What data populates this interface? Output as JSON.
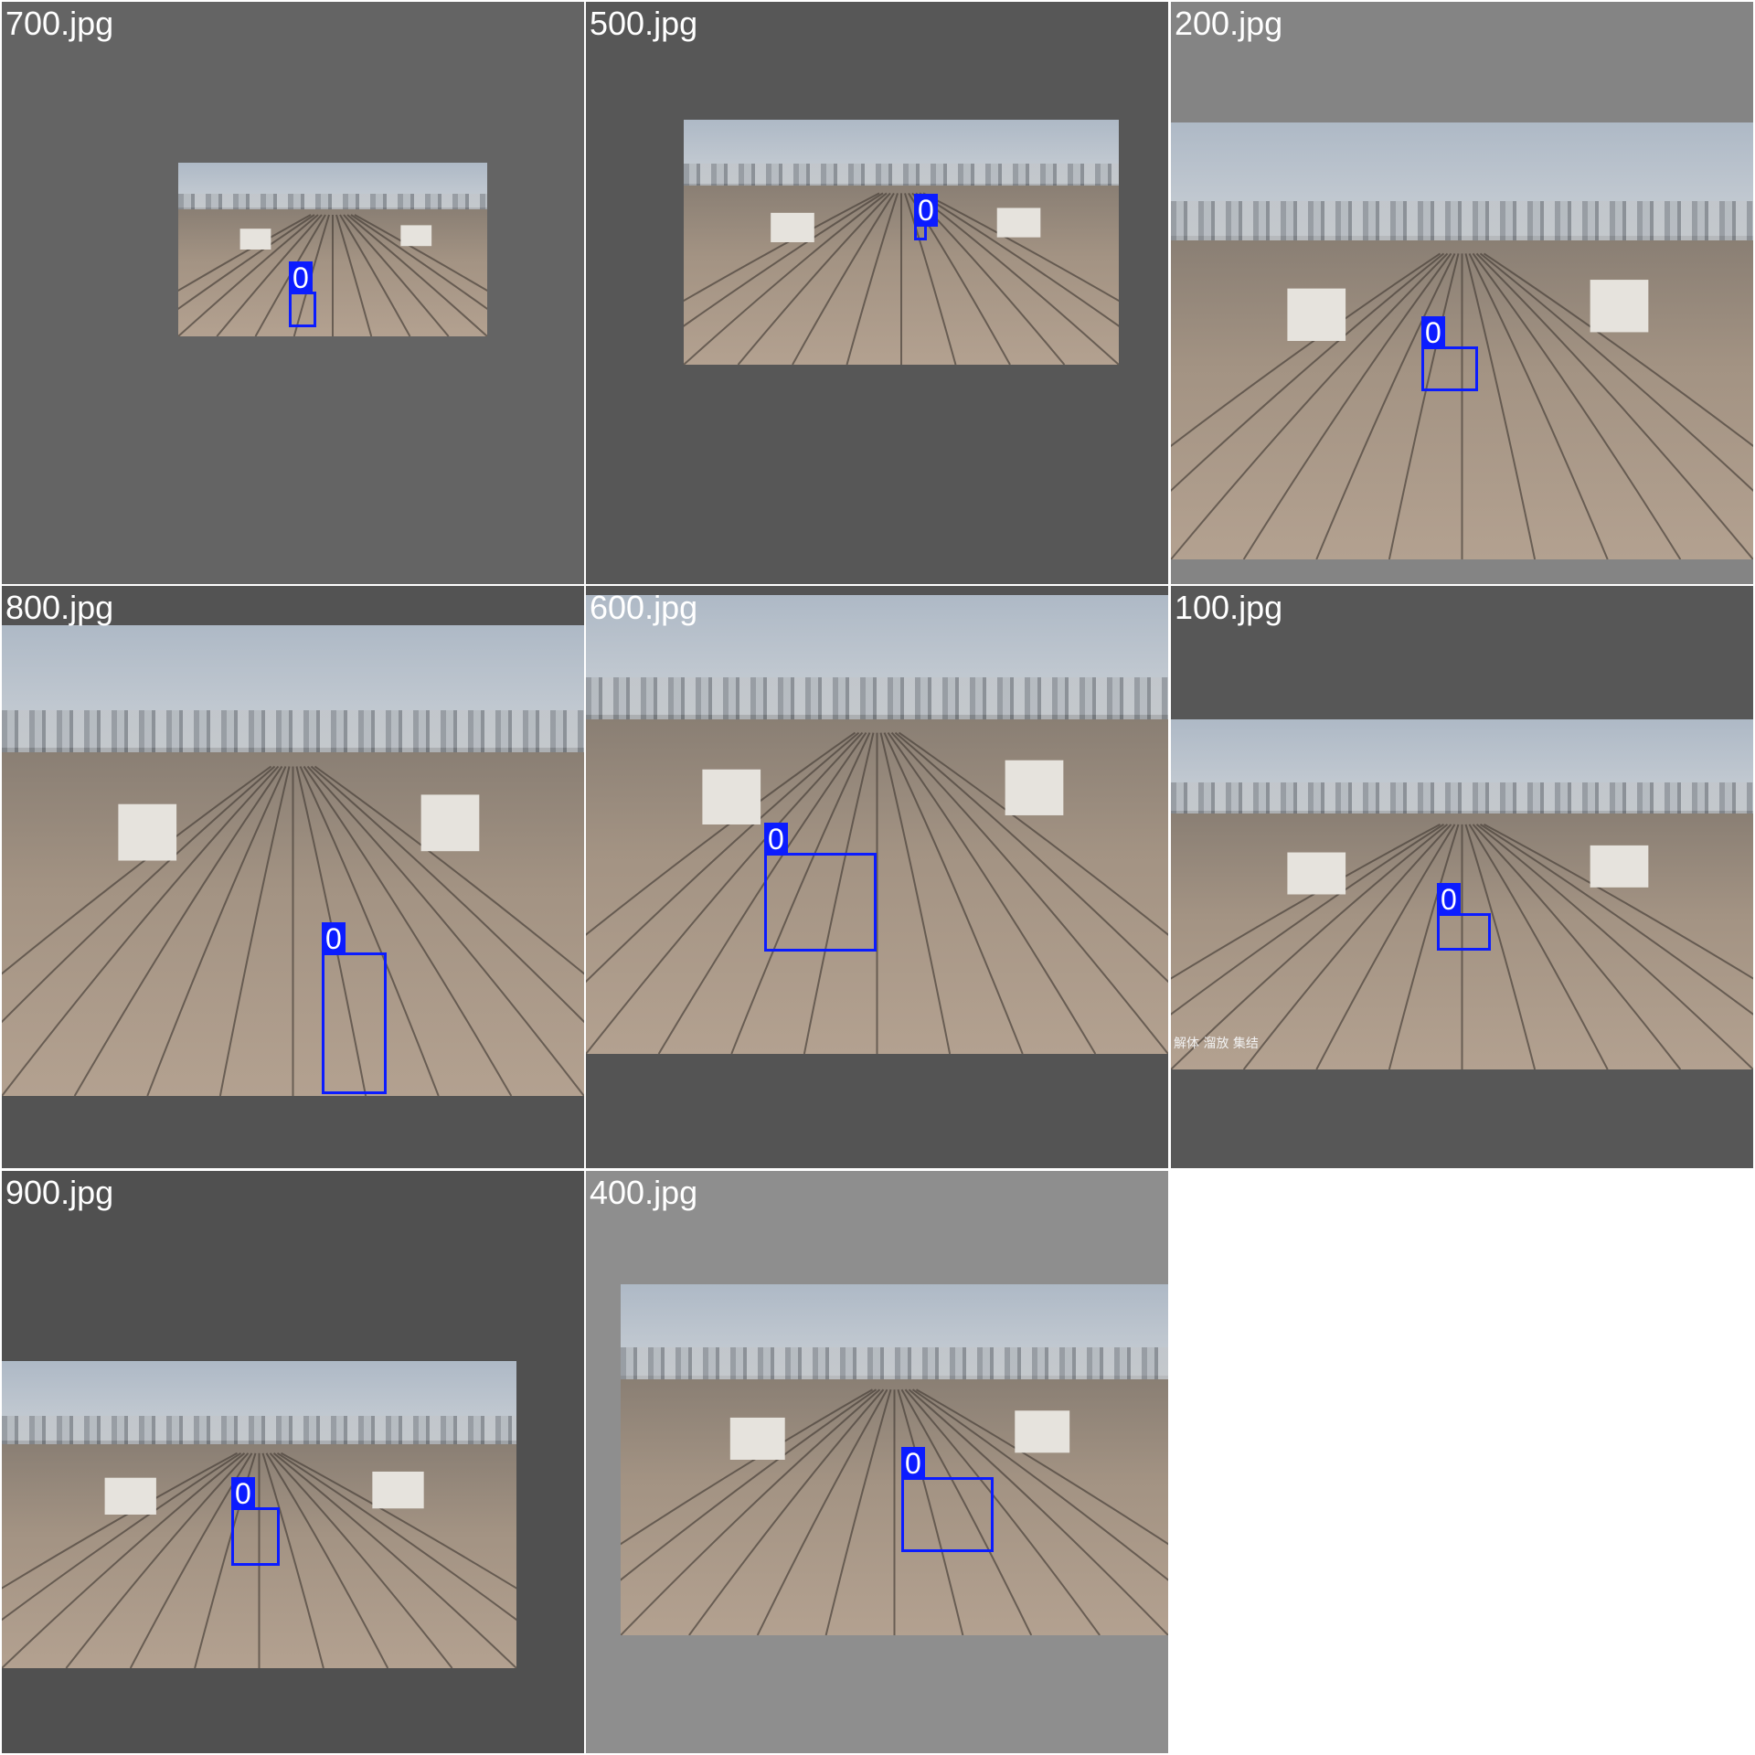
{
  "tiles": [
    {
      "label": "700.jpg",
      "box_label": "0",
      "bg": "#646464"
    },
    {
      "label": "500.jpg",
      "box_label": "0",
      "bg": "#575757"
    },
    {
      "label": "200.jpg",
      "box_label": "0",
      "bg": "#848484"
    },
    {
      "label": "800.jpg",
      "box_label": "0",
      "bg": "#535353"
    },
    {
      "label": "600.jpg",
      "box_label": "0",
      "bg": "#545454"
    },
    {
      "label": "100.jpg",
      "box_label": "0",
      "bg": "#575757",
      "caption": "解体 溜放 集结"
    },
    {
      "label": "900.jpg",
      "box_label": "0",
      "bg": "#505050"
    },
    {
      "label": "400.jpg",
      "box_label": "0",
      "bg": "#8e8e8e"
    }
  ],
  "colors": {
    "box": "#0b1cff",
    "label_text": "#ffffff",
    "separator": "#ffffff"
  }
}
